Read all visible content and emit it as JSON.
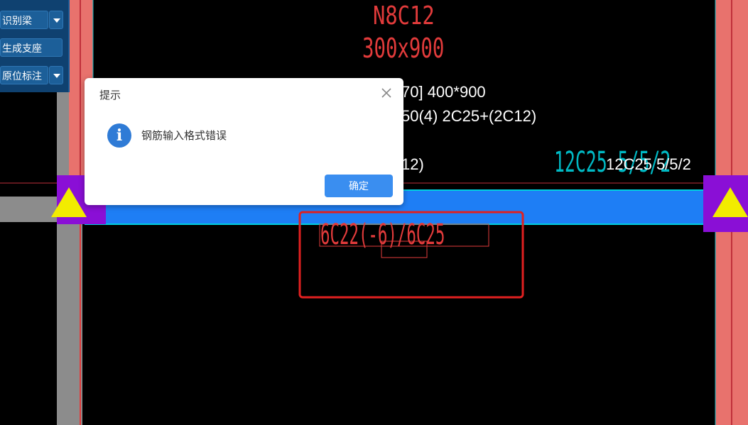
{
  "toolbar": {
    "items": [
      {
        "label": "识别梁",
        "has_dropdown": true
      },
      {
        "label": "生成支座",
        "has_dropdown": false
      },
      {
        "label": "原位标注",
        "has_dropdown": true
      }
    ]
  },
  "drawing": {
    "top_label_1": "N8C12",
    "top_label_2": "300x900",
    "beam_spec_1": "70] 400*900",
    "beam_spec_2": "50(4) 2C25+(2C12)",
    "beam_spec_3": "12)",
    "right_rebar_cyan": "12C25 5/5/2",
    "right_rebar_white": "12C25 5/5/2",
    "bottom_rebar": "6C22(-6)/6C25",
    "colors": {
      "column": "#e8726d",
      "beam": "#1e7ef5",
      "support": "#8a0fd6",
      "triangle": "#f2ec00",
      "highlight": "#e02020",
      "cad_red": "#e23b3b",
      "cyan": "#00b9c4"
    }
  },
  "dialog": {
    "title": "提示",
    "message": "钢筋输入格式错误",
    "ok_label": "确定",
    "icon": "info-icon",
    "close_icon": "close-icon"
  }
}
